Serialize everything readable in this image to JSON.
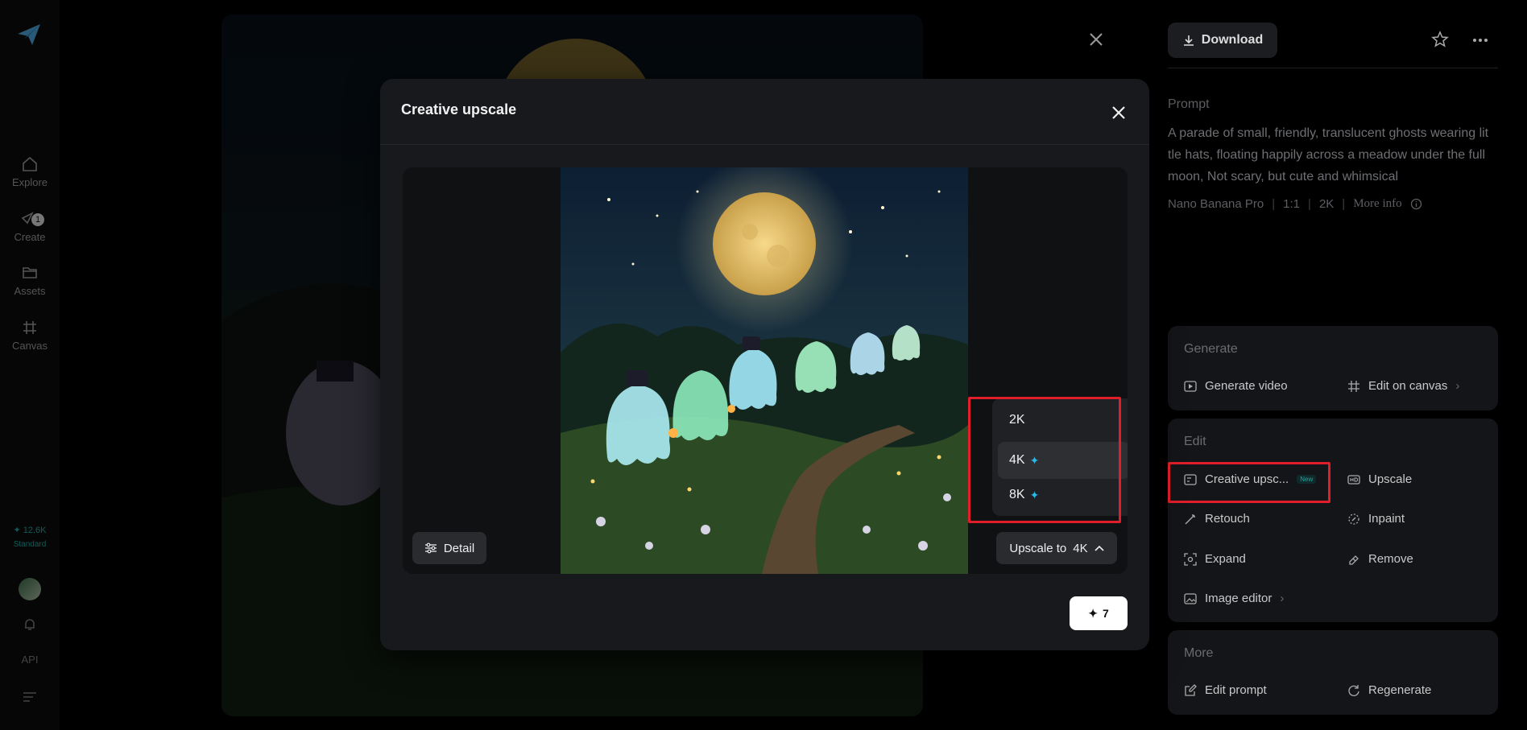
{
  "nav": {
    "items": [
      {
        "label": "Explore",
        "icon": "home-icon"
      },
      {
        "label": "Create",
        "icon": "create-icon",
        "badge": "1"
      },
      {
        "label": "Assets",
        "icon": "folder-icon"
      },
      {
        "label": "Canvas",
        "icon": "canvas-icon"
      }
    ],
    "credits": "✦ 12.6K",
    "plan": "Standard",
    "api_label": "API"
  },
  "toolbar": {
    "download_label": "Download"
  },
  "prompt": {
    "heading": "Prompt",
    "text": "A parade of small, friendly, translucent ghosts wearing lit tle hats, floating happily across a meadow under the full moon, Not scary, but cute and whimsical",
    "model": "Nano Banana Pro",
    "ratio": "1:1",
    "resolution": "2K",
    "more_info": "More info"
  },
  "generate": {
    "heading": "Generate",
    "video": "Generate video",
    "canvas": "Edit on canvas"
  },
  "edit": {
    "heading": "Edit",
    "creative": "Creative upsc...",
    "creative_badge": "New",
    "upscale": "Upscale",
    "retouch": "Retouch",
    "inpaint": "Inpaint",
    "expand": "Expand",
    "remove": "Remove",
    "image_editor": "Image editor"
  },
  "more": {
    "heading": "More",
    "edit_prompt": "Edit prompt",
    "regenerate": "Regenerate"
  },
  "modal": {
    "title": "Creative upscale",
    "detail_label": "Detail",
    "upscale_label": "Upscale to",
    "upscale_value": "4K",
    "options": [
      "2K",
      "4K",
      "8K"
    ],
    "selected": "4K",
    "cost": "7"
  },
  "colors": {
    "accent": "#2ab8e8",
    "highlight": "#e01f2a"
  }
}
